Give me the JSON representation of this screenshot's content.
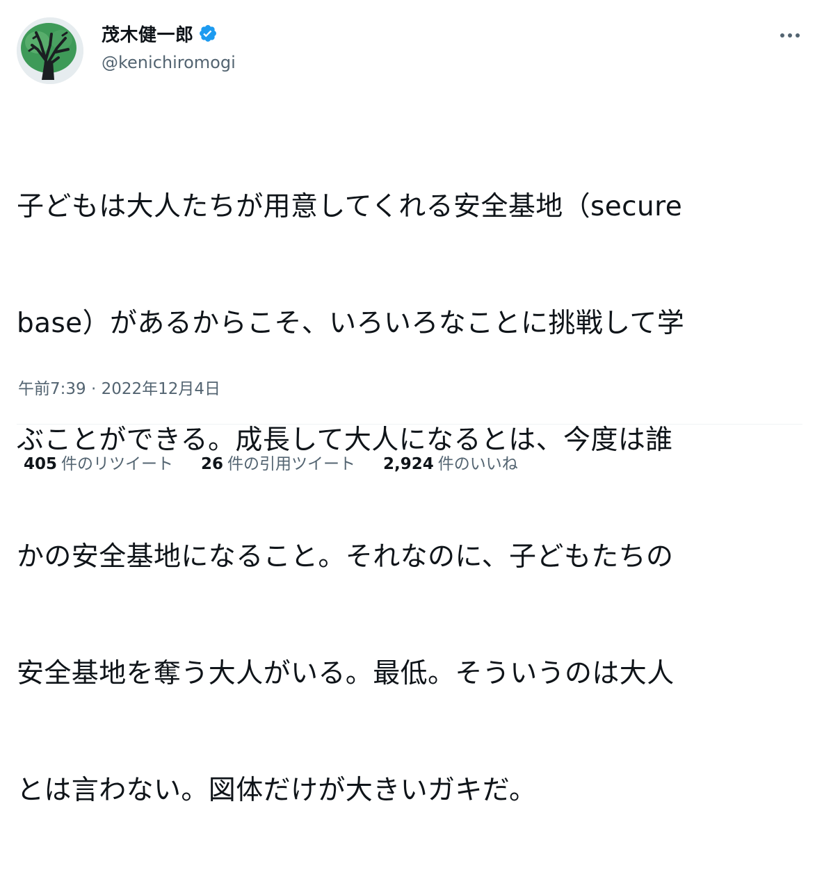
{
  "user": {
    "display_name": "茂木健一郎",
    "handle": "@kenichiromogi",
    "verified_icon": "verified-badge-icon",
    "avatar_icon": "avatar-tree-drawing"
  },
  "menu": {
    "icon": "more-horizontal-icon"
  },
  "tweet": {
    "lines": [
      "子どもは大人たちが用意してくれる安全基地（secure",
      "base）があるからこそ、いろいろなことに挑戦して学",
      "ぶことができる。成長して大人になるとは、今度は誰",
      "かの安全基地になること。それなのに、子どもたちの",
      "安全基地を奪う大人がいる。最低。そういうのは大人",
      "とは言わない。図体だけが大きいガキだ。"
    ],
    "timestamp": "午前7:39 · 2022年12月4日"
  },
  "stats": {
    "retweets_count": "405",
    "retweets_label": "件のリツイート",
    "quotes_count": "26",
    "quotes_label": "件の引用ツイート",
    "likes_count": "2,924",
    "likes_label": "件のいいね"
  },
  "colors": {
    "text_primary": "#0f1419",
    "text_secondary": "#536471",
    "verified_blue": "#1d9bf0",
    "divider": "#eff3f4"
  }
}
